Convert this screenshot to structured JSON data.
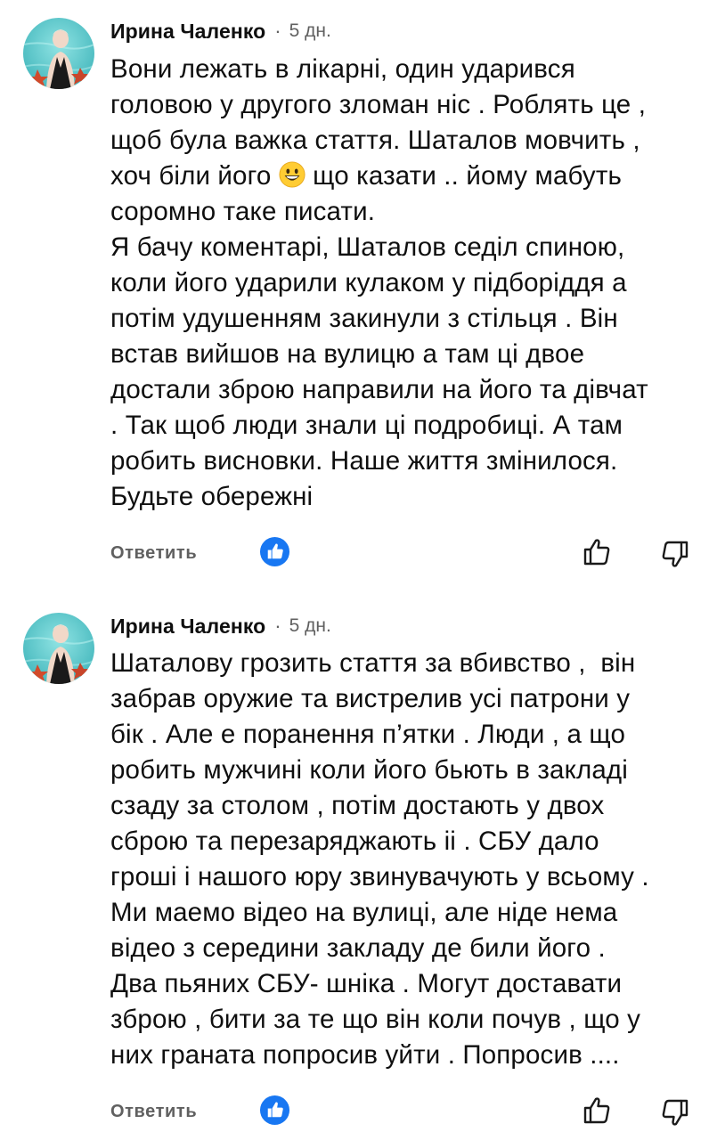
{
  "comments": [
    {
      "author": "Ирина Чаленко",
      "separator": "·",
      "time": "5 дн.",
      "lines": [
        "Вони лежать в лікарні, один ударився",
        "головою у другого зломан ніс . Роблять це ,",
        "щоб була важка стаття. Шаталов мовчить ,",
        "хоч біли його",
        "що казати .. йому мабуть",
        "соромно таке писати.",
        "Я бачу коментарі, Шаталов седіл спиною,",
        "коли його ударили кулаком у підборіддя а",
        "потім удушенням закинули з стільця . Він",
        "встав вийшов на вулицю а там ці двое",
        "достали зброю направили на його та дівчат",
        ". Так щоб люди знали ці подробиці. А там",
        "робить висновки. Наше життя змінилося.",
        "Будьте обережні"
      ],
      "emoji": "grinning-face-emoji",
      "reply_label": "Ответить"
    },
    {
      "author": "Ирина Чаленко",
      "separator": "·",
      "time": "5 дн.",
      "lines": [
        "Шаталову грозить стаття за вбивство ,  він",
        "забрав оружие та вистрелив усі патрони у",
        "бік . Але е поранення п’ятки . Люди , а що",
        "робить мужчині коли його бьють в закладі",
        "сзаду за столом , потім достають у двох",
        "сброю та перезаряджають іі . СБУ дало",
        "гроші і нашого юру звинувачують у всьому .",
        "Ми маемо відео на вулиці, але ніде нема",
        "відео з середини закладу де били його .",
        "Два пьяних СБУ- шніка . Могут доставати",
        "зброю , бити за те що він коли почув , що у",
        "них граната попросив уйти . Попросив ...."
      ],
      "reply_label": "Ответить"
    }
  ],
  "colors": {
    "text": "#0f0f0f",
    "secondary": "#606060",
    "like_badge": "#1877f2",
    "avatar_bg": "#5cc7c9"
  },
  "icons": [
    "avatar",
    "like-reaction-icon",
    "thumb-up-icon",
    "thumb-down-icon",
    "grinning-face-emoji"
  ]
}
